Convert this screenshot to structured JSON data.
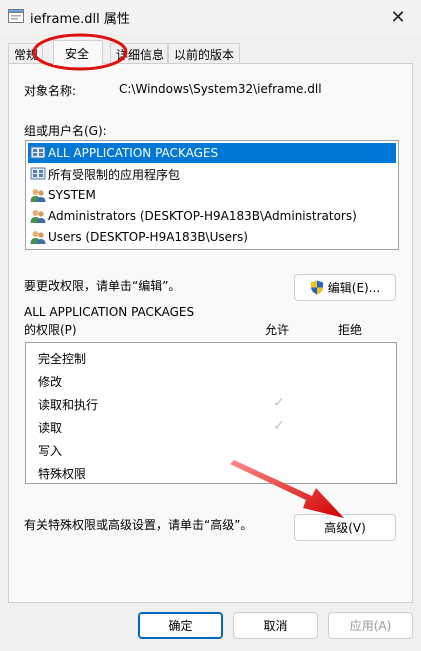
{
  "window": {
    "title": "ieframe.dll 属性",
    "close_glyph": "✕"
  },
  "tabs": [
    "常规",
    "安全",
    "详细信息",
    "以前的版本"
  ],
  "active_tab": "安全",
  "object": {
    "label": "对象名称:",
    "value": "C:\\Windows\\System32\\ieframe.dll"
  },
  "groups": {
    "label": "组或用户名(G):",
    "items": [
      {
        "icon": "app-packages-icon",
        "label": "ALL APPLICATION PACKAGES",
        "selected": true
      },
      {
        "icon": "app-packages-icon",
        "label": "所有受限制的应用程序包",
        "selected": false
      },
      {
        "icon": "users-icon",
        "label": "SYSTEM",
        "selected": false
      },
      {
        "icon": "users-icon",
        "label": "Administrators (DESKTOP-H9A183B\\Administrators)",
        "selected": false
      },
      {
        "icon": "users-icon",
        "label": "Users (DESKTOP-H9A183B\\Users)",
        "selected": false
      }
    ]
  },
  "change_hint": "要更改权限，请单击“编辑”。",
  "edit_button": {
    "label": "编辑(E)...",
    "icon": "shield-icon"
  },
  "permissions": {
    "for_line1": "ALL APPLICATION PACKAGES",
    "for_line2": "的权限(P)",
    "allow_header": "允许",
    "deny_header": "拒绝",
    "rows": [
      {
        "name": "完全控制",
        "allow": false,
        "deny": false
      },
      {
        "name": "修改",
        "allow": false,
        "deny": false
      },
      {
        "name": "读取和执行",
        "allow": true,
        "deny": false
      },
      {
        "name": "读取",
        "allow": true,
        "deny": false
      },
      {
        "name": "写入",
        "allow": false,
        "deny": false
      },
      {
        "name": "特殊权限",
        "allow": false,
        "deny": false
      }
    ]
  },
  "advanced_hint": "有关特殊权限或高级设置，请单击“高级”。",
  "advanced_button": "高级(V)",
  "footer": {
    "ok": "确定",
    "cancel": "取消",
    "apply": "应用(A)"
  },
  "colors": {
    "selection": "#0078d7",
    "annotation": "#e01010",
    "default_button_border": "#0067c0"
  }
}
